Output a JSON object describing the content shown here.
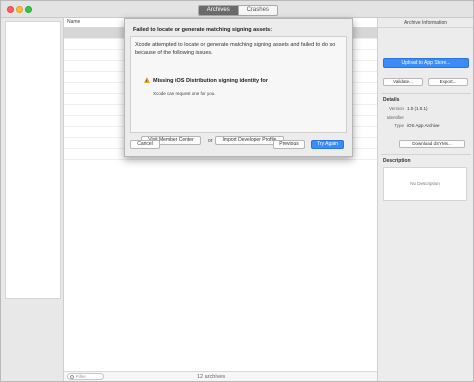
{
  "toolbar": {
    "tabs": [
      {
        "label": "Archives",
        "active": true
      },
      {
        "label": "Crashes",
        "active": false
      }
    ]
  },
  "list": {
    "column_header": "Name",
    "filter_placeholder": "Filter",
    "archive_count": "12 archives"
  },
  "inspector": {
    "title": "Archive Information",
    "upload_button": "Upload to App Store...",
    "validate_button": "Validate...",
    "export_button": "Export...",
    "details_heading": "Details",
    "details": [
      {
        "key": "Version",
        "value": "1.0 (1.0.1)"
      },
      {
        "key": "Identifier",
        "value": ""
      },
      {
        "key": "Type",
        "value": "iOS App Archive"
      }
    ],
    "dsym_button": "Download dSYMs...",
    "description_heading": "Description",
    "description_placeholder": "No Description"
  },
  "dialog": {
    "title": "Failed to locate or generate matching signing assets:",
    "message": "Xcode attempted to locate or generate matching signing assets and failed to do so because of the following issues.",
    "issue_icon": "warning-icon",
    "issue_title": "Missing iOS Distribution signing identity for",
    "issue_detail": "Xcode can request one for you.",
    "visit_button": "Visit Member Center",
    "or_text": "or",
    "import_button": "Import Developer Profile",
    "cancel_button": "Cancel",
    "previous_button": "Previous",
    "try_again_button": "Try Again"
  },
  "colors": {
    "accent": "#3a8cf7",
    "warning": "#e9a12a",
    "selected_row": "#d6d6d6"
  }
}
